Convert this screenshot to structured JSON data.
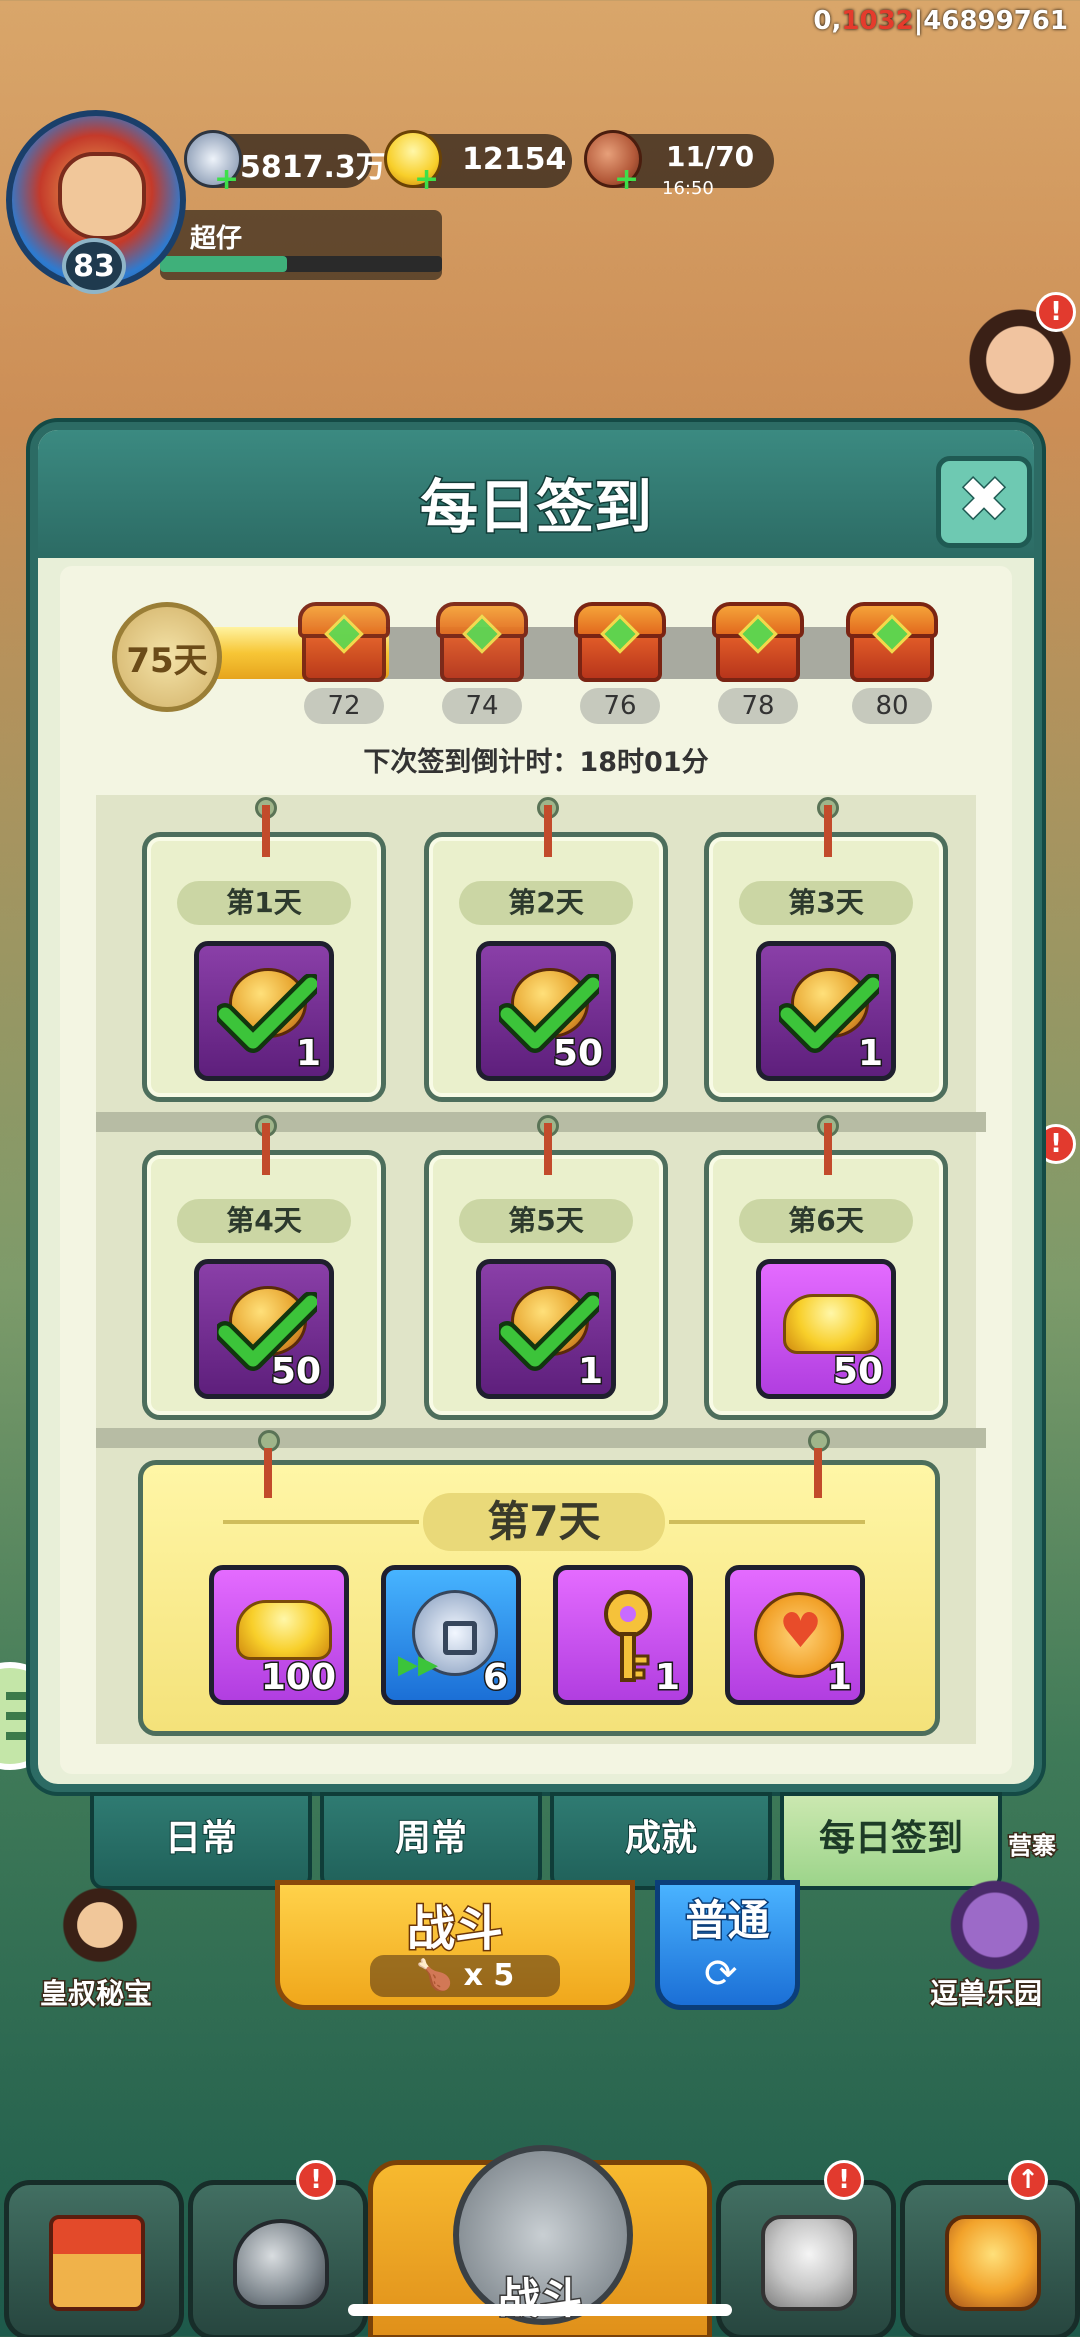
{
  "debug": {
    "prefix": "0,",
    "highlight": "1032",
    "suffix": "|46899761"
  },
  "player": {
    "name": "超仔",
    "level": "83",
    "exp_fraction": 0.45
  },
  "resources": {
    "silver": {
      "icon": "silver-coin-icon",
      "value": "5817.3万"
    },
    "gold": {
      "icon": "gold-ingot-icon",
      "value": "12154"
    },
    "stamina": {
      "icon": "drumstick-icon",
      "value": "11/70",
      "timer": "16:50"
    }
  },
  "modal": {
    "title": "每日签到",
    "close_icon": "close-icon",
    "streak_label": "75天",
    "progress_fraction": 0.27,
    "milestones": [
      {
        "label": "72",
        "opened": true
      },
      {
        "label": "74",
        "opened": true
      },
      {
        "label": "76",
        "opened": false
      },
      {
        "label": "78",
        "opened": false
      },
      {
        "label": "80",
        "opened": false
      }
    ],
    "countdown": "下次签到倒计时：18时01分",
    "days": [
      {
        "label": "第1天",
        "qty": "1",
        "icon": "orb-icon",
        "claimed": true,
        "style": "purple"
      },
      {
        "label": "第2天",
        "qty": "50",
        "icon": "orb-icon",
        "claimed": true,
        "style": "purple"
      },
      {
        "label": "第3天",
        "qty": "1",
        "icon": "orb-icon",
        "claimed": true,
        "style": "purple"
      },
      {
        "label": "第4天",
        "qty": "50",
        "icon": "orb-icon",
        "claimed": true,
        "style": "purple"
      },
      {
        "label": "第5天",
        "qty": "1",
        "icon": "orb-icon",
        "claimed": true,
        "style": "purple"
      },
      {
        "label": "第6天",
        "qty": "50",
        "icon": "gold-ingot-icon",
        "claimed": false,
        "style": "purple-bright"
      }
    ],
    "day7": {
      "label": "第7天",
      "items": [
        {
          "icon": "gold-ingot-icon",
          "qty": "100",
          "style": "purple-bright"
        },
        {
          "icon": "silver-coin-fast-icon",
          "qty": "6",
          "style": "blue"
        },
        {
          "icon": "key-icon",
          "qty": "1",
          "style": "purple-bright"
        },
        {
          "icon": "heart-coin-icon",
          "qty": "1",
          "style": "purple-bright"
        }
      ]
    }
  },
  "tabs": [
    {
      "label": "日常",
      "active": false
    },
    {
      "label": "周常",
      "active": false
    },
    {
      "label": "成就",
      "active": false
    },
    {
      "label": "每日签到",
      "active": true
    }
  ],
  "battle": {
    "label": "战斗",
    "cost": "x 5",
    "mode": "普通"
  },
  "side_features": {
    "left": "皇叔秘宝",
    "right": "逗兽乐园",
    "right_top": "营寨"
  },
  "bottom_nav": {
    "battle_label": "战斗"
  },
  "colors": {
    "accent_teal": "#2c6b64",
    "gold": "#f7c636",
    "alert_red": "#e23a2e"
  }
}
